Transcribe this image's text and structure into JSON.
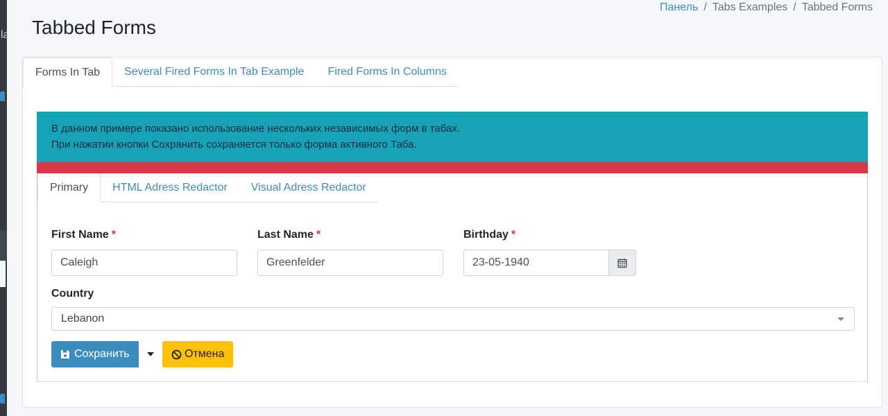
{
  "breadcrumb": {
    "home": "Панель",
    "section": "Tabs Examples",
    "current": "Tabbed Forms",
    "separator": "/"
  },
  "page": {
    "title": "Tabbed Forms"
  },
  "sidebar_fragment": {
    "text": "la"
  },
  "tabs": [
    {
      "label": "Forms In Tab",
      "active": true
    },
    {
      "label": "Several Fired Forms In Tab Example",
      "active": false
    },
    {
      "label": "Fired Forms In Columns",
      "active": false
    }
  ],
  "info": {
    "line1": "В данном примере показано использование нескольких независимых форм в табах.",
    "line2": "При нажатии кнопки Сохранить сохраняется только форма активного Таба."
  },
  "inner_tabs": [
    {
      "label": "Primary",
      "active": true
    },
    {
      "label": "HTML Adress Redactor",
      "active": false
    },
    {
      "label": "Visual Adress Redactor",
      "active": false
    }
  ],
  "form": {
    "first_name": {
      "label": "First Name",
      "required_mark": "*",
      "value": "Caleigh"
    },
    "last_name": {
      "label": "Last Name",
      "required_mark": "*",
      "value": "Greenfelder"
    },
    "birthday": {
      "label": "Birthday",
      "required_mark": "*",
      "value": "23-05-1940"
    },
    "country": {
      "label": "Country",
      "value": "Lebanon"
    }
  },
  "buttons": {
    "save": "Сохранить",
    "cancel": "Отмена"
  },
  "icons": {
    "calendar": "calendar-icon",
    "save": "floppy-disk-icon",
    "cancel": "ban-icon",
    "dropdown": "caret-down-icon"
  },
  "colors": {
    "primary": "#3c8dbc",
    "info": "#17a2b8",
    "danger": "#dc3545",
    "warning": "#ffc107"
  }
}
